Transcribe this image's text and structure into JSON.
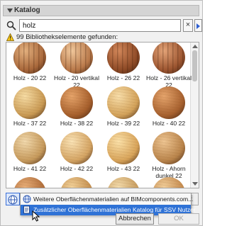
{
  "panel": {
    "title": "Katalog"
  },
  "search": {
    "value": "holz",
    "placeholder": "",
    "clear_label": "×"
  },
  "status": {
    "message": "99 Bibliothekselemente gefunden:"
  },
  "colors": {
    "accent": "#2f72d6",
    "header_bg": "#d4d4d4"
  },
  "materials": [
    {
      "label": "Holz - 20 22",
      "tone": "#a8673a",
      "light": "#e3b07e",
      "stripe": true
    },
    {
      "label": "Holz - 20 vertikal 22",
      "tone": "#b9794a",
      "light": "#f0c79b",
      "stripe": true
    },
    {
      "label": "Holz - 26 22",
      "tone": "#8e4a26",
      "light": "#d2875a",
      "stripe": true
    },
    {
      "label": "Holz - 26 vertikal 22",
      "tone": "#9c5530",
      "light": "#e3a377",
      "stripe": true
    },
    {
      "label": "Holz - 37 22",
      "tone": "#c99a54",
      "light": "#f6dca4",
      "stripe": false
    },
    {
      "label": "Holz - 38 22",
      "tone": "#a65f2c",
      "light": "#e6a46a",
      "stripe": false
    },
    {
      "label": "Holz - 39 22",
      "tone": "#d3a25a",
      "light": "#f8deaa",
      "stripe": false
    },
    {
      "label": "Holz - 40 22",
      "tone": "#a7612f",
      "light": "#e5a46c",
      "stripe": false
    },
    {
      "label": "Holz - 41 22",
      "tone": "#c69a5c",
      "light": "#f1d9ad",
      "stripe": false
    },
    {
      "label": "Holz - 42 22",
      "tone": "#d4a463",
      "light": "#fae3b6",
      "stripe": false
    },
    {
      "label": "Holz - 43 22",
      "tone": "#d8a45a",
      "light": "#fbe1a9",
      "stripe": false
    },
    {
      "label": "Holz - Ahorn dunkel 22",
      "tone": "#b9844b",
      "light": "#eec592",
      "stripe": false
    },
    {
      "label": "",
      "tone": "#b06d3a",
      "light": "#e7ad78",
      "stripe": false
    },
    {
      "label": "",
      "tone": "#c48f4f",
      "light": "#f2d199",
      "stripe": false
    },
    {
      "label": "",
      "tone": "#c79c5f",
      "light": "#f3dbab",
      "stripe": false
    },
    {
      "label": "",
      "tone": "#c48a4e",
      "light": "#f0cc98",
      "stripe": false
    }
  ],
  "menu": {
    "items": [
      {
        "label": "Weitere Oberflächenmaterialien auf BIMcomponents.com..."
      },
      {
        "label": "Zusätzlicher Oberflächenmaterialien Katalog für SSV Nutzer"
      }
    ]
  },
  "footer": {
    "cancel_label": "Abbrechen",
    "ok_label": "OK",
    "info_label": "i"
  }
}
